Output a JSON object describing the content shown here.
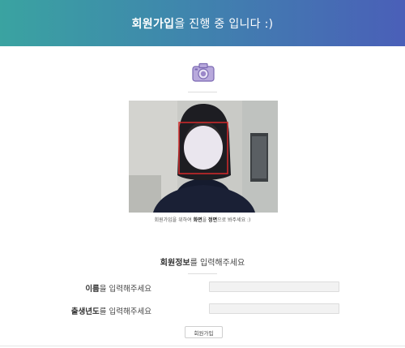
{
  "header": {
    "title_strong": "회원가입",
    "title_rest": "을 진행 중 입니다 :)",
    "gradient_start": "#3aa3a1",
    "gradient_end": "#4a5fb8"
  },
  "camera": {
    "icon": "camera-icon",
    "color": "#9b87c9"
  },
  "caption": {
    "before": "회원가입을 위하여 ",
    "bold1": "화면",
    "mid": "을 ",
    "bold2": "정면",
    "after": "으로 봐주세요 :)"
  },
  "form": {
    "title_strong": "회원정보",
    "title_rest": "를 입력해주세요",
    "name_strong": "이름",
    "name_rest": "을 입력해주세요",
    "birth_strong": "출생년도",
    "birth_rest": "를 입력해주세요",
    "name_value": "",
    "birth_value": "",
    "submit_label": "회원가입"
  },
  "colors": {
    "face_box": "#d42a2a",
    "input_bg": "#f2f2f2"
  }
}
